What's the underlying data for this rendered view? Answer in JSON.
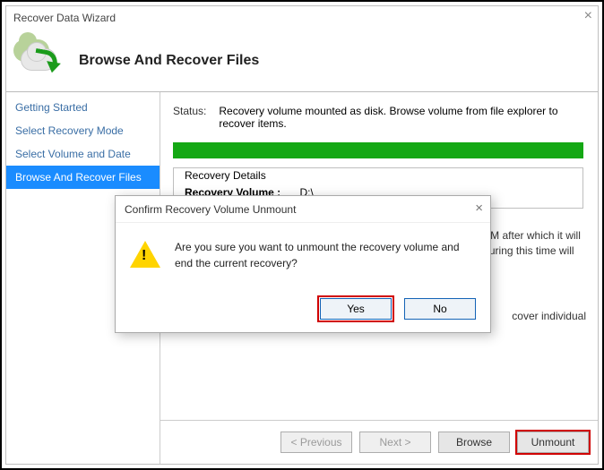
{
  "window": {
    "title": "Recover Data Wizard",
    "heading": "Browse And Recover Files"
  },
  "sidebar": {
    "items": [
      {
        "label": "Getting Started"
      },
      {
        "label": "Select Recovery Mode"
      },
      {
        "label": "Select Volume and Date"
      },
      {
        "label": "Browse And Recover Files"
      }
    ],
    "activeIndex": 3
  },
  "status": {
    "label": "Status:",
    "text": "Recovery volume mounted as disk. Browse volume from file explorer to recover items."
  },
  "details": {
    "legend": "Recovery Details",
    "volumeLabel": "Recovery Volume :",
    "volumeValue": "D:\\"
  },
  "cutoffText": "cover individual",
  "note": "Recovery volume will remain mounted till 1/31/2017 8:36:03 AM after which it will be automatically unmounted. Any backups scheduled to run during this time will run only after the volume is unmounted.",
  "footer": {
    "previous": "< Previous",
    "next": "Next >",
    "browse": "Browse",
    "unmount": "Unmount"
  },
  "dialog": {
    "title": "Confirm Recovery Volume Unmount",
    "message": "Are you sure you want to unmount the recovery volume and end the current recovery?",
    "yes": "Yes",
    "no": "No"
  }
}
